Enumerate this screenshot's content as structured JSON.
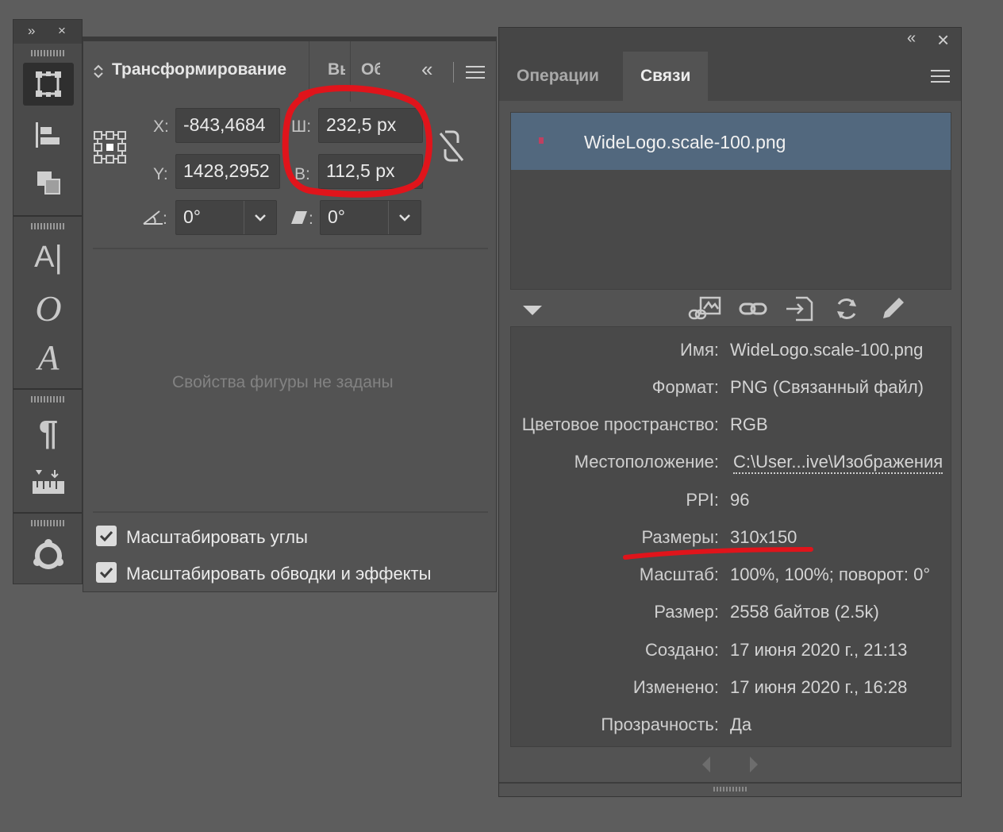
{
  "tool_panel": {
    "expand_glyph": "»",
    "close_glyph": "×"
  },
  "transform_panel": {
    "title": "Трансформирование",
    "tab_2": "Вы",
    "tab_3": "Об",
    "collapse_glyph": "«",
    "x_label": "X:",
    "x_value": "-843,4684",
    "y_label": "Y:",
    "y_value": "1428,2952",
    "w_label": "Ш:",
    "w_value": "232,5 px",
    "h_label": "В:",
    "h_value": "112,5 px",
    "angle_value": "0°",
    "shear_value": "0°",
    "colon": ":",
    "empty_message": "Свойства фигуры не заданы",
    "scale_corners_label": "Масштабировать углы",
    "scale_corners_checked": true,
    "scale_strokes_label": "Масштабировать обводки и эффекты",
    "scale_strokes_checked": true
  },
  "links_panel": {
    "collapse_glyph": "«",
    "close_glyph": "×",
    "tabs": [
      {
        "label": "Операции",
        "active": false
      },
      {
        "label": "Связи",
        "active": true
      }
    ],
    "selected_file": "WideLogo.scale-100.png",
    "info": [
      {
        "key": "Имя:",
        "value": "WideLogo.scale-100.png"
      },
      {
        "key": "Формат:",
        "value": "PNG (Связанный файл)"
      },
      {
        "key": "Цветовое пространство:",
        "value": "RGB"
      },
      {
        "key": "Местоположение:",
        "value": "C:\\User...ive\\Изображения"
      },
      {
        "key": "PPI:",
        "value": "96"
      },
      {
        "key": "Размеры:",
        "value": "310x150"
      },
      {
        "key": "Масштаб:",
        "value": "100%, 100%; поворот: 0°"
      },
      {
        "key": "Размер:",
        "value": "2558 байтов (2.5k)"
      },
      {
        "key": "Создано:",
        "value": "17 июня 2020 г., 21:13"
      },
      {
        "key": "Изменено:",
        "value": "17 июня 2020 г., 16:28"
      },
      {
        "key": "Прозрачность:",
        "value": "Да"
      }
    ]
  },
  "annotation_color": "#e0141b"
}
